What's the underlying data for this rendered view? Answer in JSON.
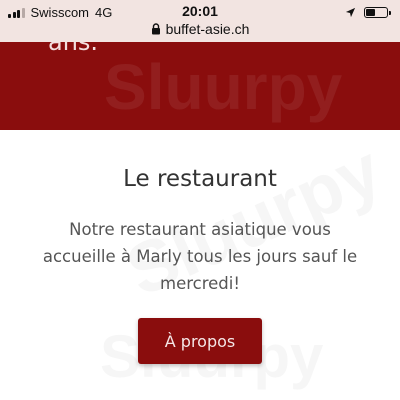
{
  "status_bar": {
    "carrier": "Swisscom",
    "network": "4G",
    "time": "20:01",
    "url": "buffet-asie.ch"
  },
  "hero": {
    "text": "ans."
  },
  "section": {
    "title": "Le restaurant",
    "text": "Notre restaurant asiatique vous accueille à Marly tous les jours sauf le mercredi!",
    "button_label": "À propos"
  },
  "watermark": "Sluurpy",
  "colors": {
    "brand_red": "#8a0d0d",
    "status_bar_bg": "#f2e4e1"
  }
}
